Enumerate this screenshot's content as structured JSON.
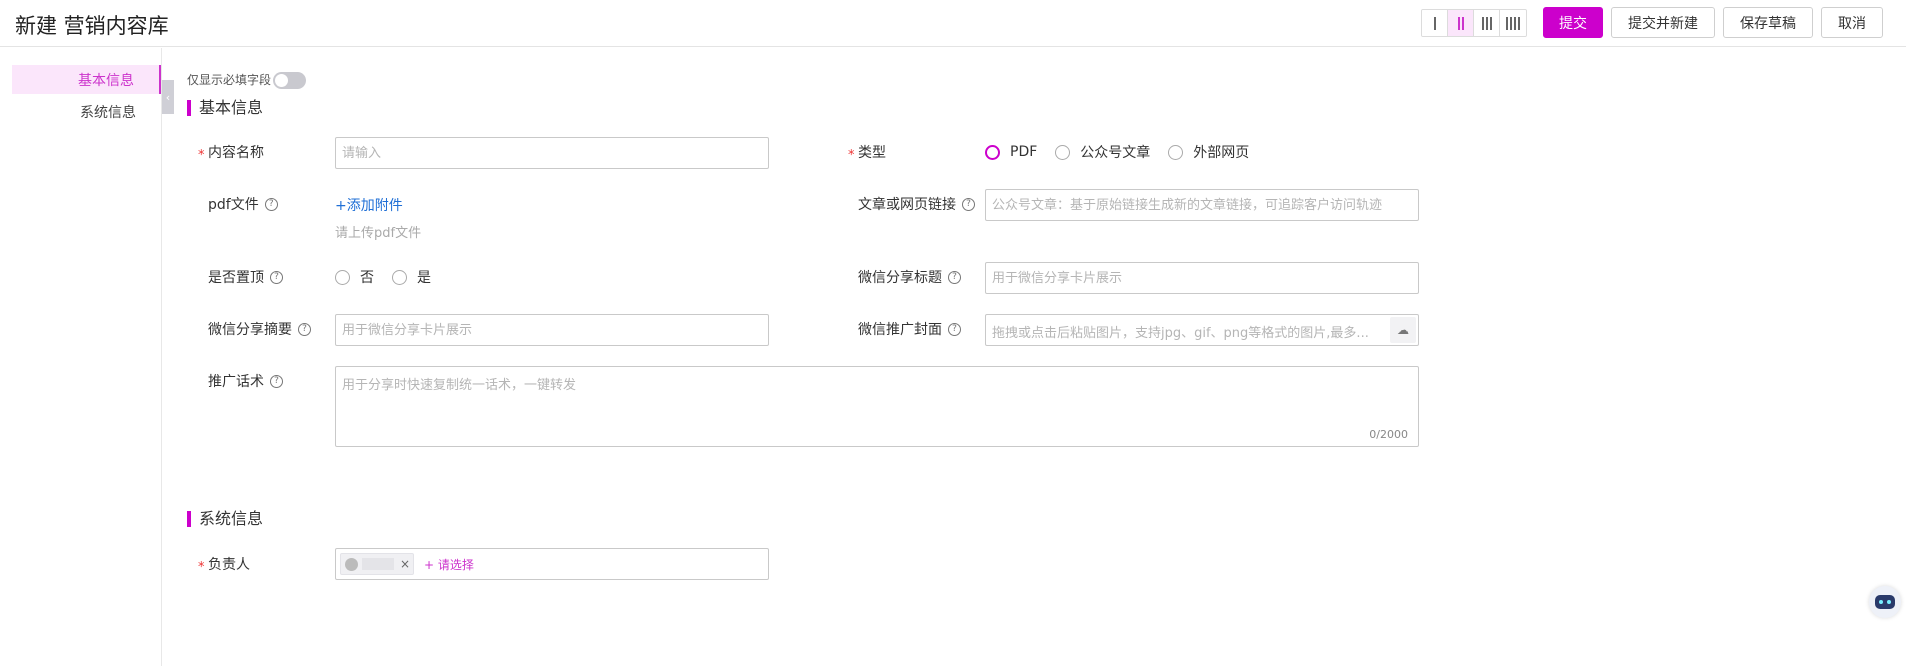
{
  "header": {
    "title": "新建 营销内容库",
    "buttons": {
      "submit": "提交",
      "submit_new": "提交并新建",
      "save_draft": "保存草稿",
      "cancel": "取消"
    }
  },
  "sidebar": {
    "items": [
      {
        "label": "基本信息",
        "active": true
      },
      {
        "label": "系统信息",
        "active": false
      }
    ]
  },
  "toggle": {
    "label": "仅显示必填字段",
    "on": false
  },
  "sections": {
    "basic": "基本信息",
    "system": "系统信息"
  },
  "form": {
    "content_name": {
      "label": "内容名称",
      "placeholder": "请输入"
    },
    "type": {
      "label": "类型",
      "options": [
        "PDF",
        "公众号文章",
        "外部网页"
      ],
      "selected": "PDF"
    },
    "pdf_file": {
      "label": "pdf文件",
      "add": "+添加附件",
      "hint": "请上传pdf文件"
    },
    "article_link": {
      "label": "文章或网页链接",
      "placeholder": "公众号文章：基于原始链接生成新的文章链接，可追踪客户访问轨迹"
    },
    "pin_top": {
      "label": "是否置顶",
      "options": [
        "否",
        "是"
      ]
    },
    "wechat_title": {
      "label": "微信分享标题",
      "placeholder": "用于微信分享卡片展示"
    },
    "wechat_summary": {
      "label": "微信分享摘要",
      "placeholder": "用于微信分享卡片展示"
    },
    "wechat_cover": {
      "label": "微信推广封面",
      "placeholder": "拖拽或点击后粘贴图片，支持jpg、gif、png等格式的图片,最多..."
    },
    "promo_script": {
      "label": "推广话术",
      "placeholder": "用于分享时快速复制统一话术，一键转发",
      "count": "0/2000"
    },
    "owner": {
      "label": "负责人",
      "add": "+ 请选择"
    }
  },
  "colors": {
    "accent": "#cc00cc",
    "link": "#1f6fd6"
  }
}
